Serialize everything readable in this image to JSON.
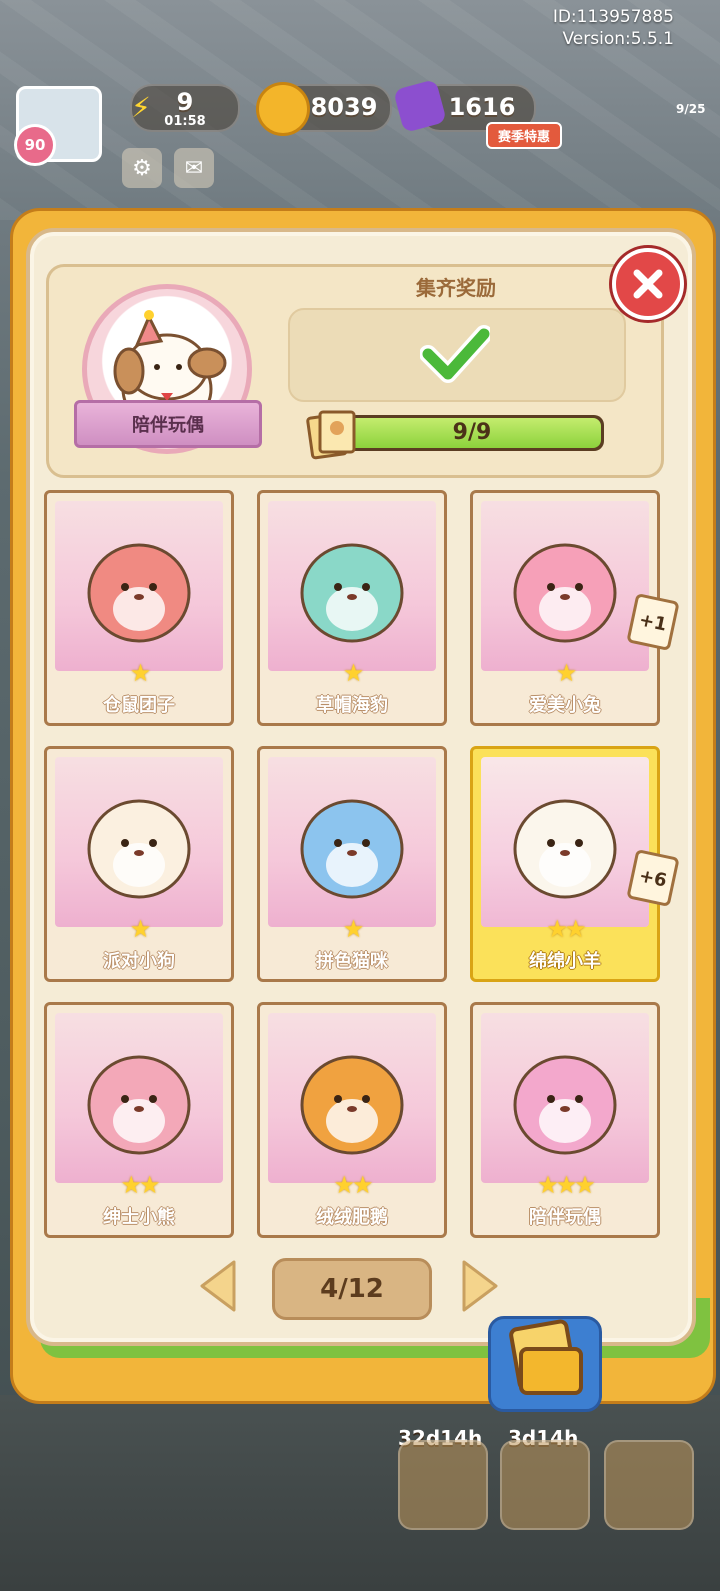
{
  "account": {
    "id_line": "ID:113957885",
    "version_line": "Version:5.5.1"
  },
  "hud": {
    "level": "90",
    "energy": {
      "value": "9",
      "timer": "01:58"
    },
    "coins": "8039",
    "gems": "1616",
    "promo_label": "赛季特惠",
    "task_counter": "9/25"
  },
  "header": {
    "collection_name": "陪伴玩偶",
    "reward_title": "集齐奖励",
    "progress_text": "9/9",
    "progress_fraction": 1.0
  },
  "cards": [
    {
      "name": "仓鼠团子",
      "stars": "★",
      "badge": ""
    },
    {
      "name": "草帽海豹",
      "stars": "★",
      "badge": ""
    },
    {
      "name": "爱美小兔",
      "stars": "★",
      "badge": "+1"
    },
    {
      "name": "派对小狗",
      "stars": "★",
      "badge": ""
    },
    {
      "name": "拼色猫咪",
      "stars": "★",
      "badge": ""
    },
    {
      "name": "绵绵小羊",
      "stars": "★★",
      "badge": "+6"
    },
    {
      "name": "绅士小熊",
      "stars": "★★",
      "badge": ""
    },
    {
      "name": "绒绒肥鹅",
      "stars": "★★",
      "badge": ""
    },
    {
      "name": "陪伴玩偶",
      "stars": "★★★",
      "badge": ""
    }
  ],
  "pagination": {
    "label": "4/12"
  },
  "bottom": {
    "timer_1": "32d14h",
    "timer_2": "3d14h"
  },
  "colors": {
    "accent_gold": "#fbe15a",
    "close_red": "#e24848",
    "progress_green": "#8cd23c"
  }
}
